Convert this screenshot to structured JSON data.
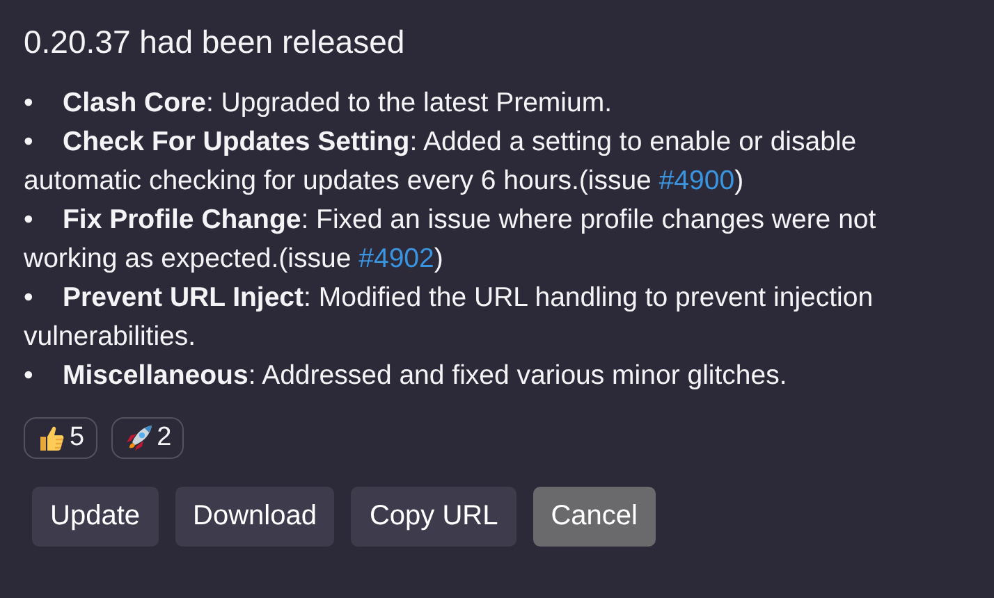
{
  "title": "0.20.37 had been released",
  "notes": [
    {
      "bullet": "•",
      "text": "**Clash Core**: Upgraded to the latest Premium."
    },
    {
      "bullet": "•",
      "text": "**Check For Updates Setting**: Added a setting to enable or disable automatic checking for updates every 6 hours.(issue ",
      "link": "#4900",
      "after": ")"
    },
    {
      "bullet": "•",
      "text": "**Fix Profile Change**: Fixed an issue where profile changes were not working as expected.(issue ",
      "link": "#4902",
      "after": ")"
    },
    {
      "bullet": "•",
      "text": "**Prevent URL Inject**: Modified the URL handling to prevent injection vulnerabilities."
    },
    {
      "bullet": "•",
      "text": "**Miscellaneous**: Addressed and fixed various minor glitches."
    }
  ],
  "reactions": [
    {
      "kind": "thumbs-up",
      "count": "5"
    },
    {
      "kind": "rocket",
      "count": "2"
    }
  ],
  "buttons": [
    {
      "label": "Update",
      "kind": "action"
    },
    {
      "label": "Download",
      "kind": "action"
    },
    {
      "label": "Copy URL",
      "kind": "action"
    },
    {
      "label": "Cancel",
      "kind": "cancel"
    }
  ]
}
